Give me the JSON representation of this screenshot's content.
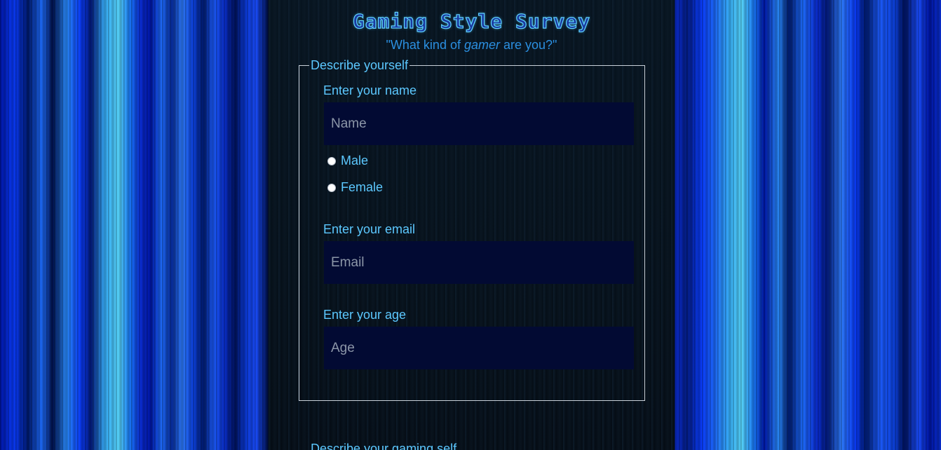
{
  "page": {
    "title": "Gaming Style Survey",
    "subtitle_prefix": "\"What kind of ",
    "subtitle_em": "gamer",
    "subtitle_suffix": " are you?\""
  },
  "section1": {
    "legend": "Describe yourself",
    "name": {
      "label": "Enter your name",
      "placeholder": "Name",
      "value": ""
    },
    "gender_options": [
      "Male",
      "Female"
    ],
    "email": {
      "label": "Enter your email",
      "placeholder": "Email",
      "value": ""
    },
    "age": {
      "label": "Enter your age",
      "placeholder": "Age",
      "value": ""
    }
  },
  "section2": {
    "legend_partial": "Describe your gaming self"
  },
  "colors": {
    "accent": "#5cc8ff",
    "input_bg": "#020a33",
    "border": "#c8d0d8"
  }
}
